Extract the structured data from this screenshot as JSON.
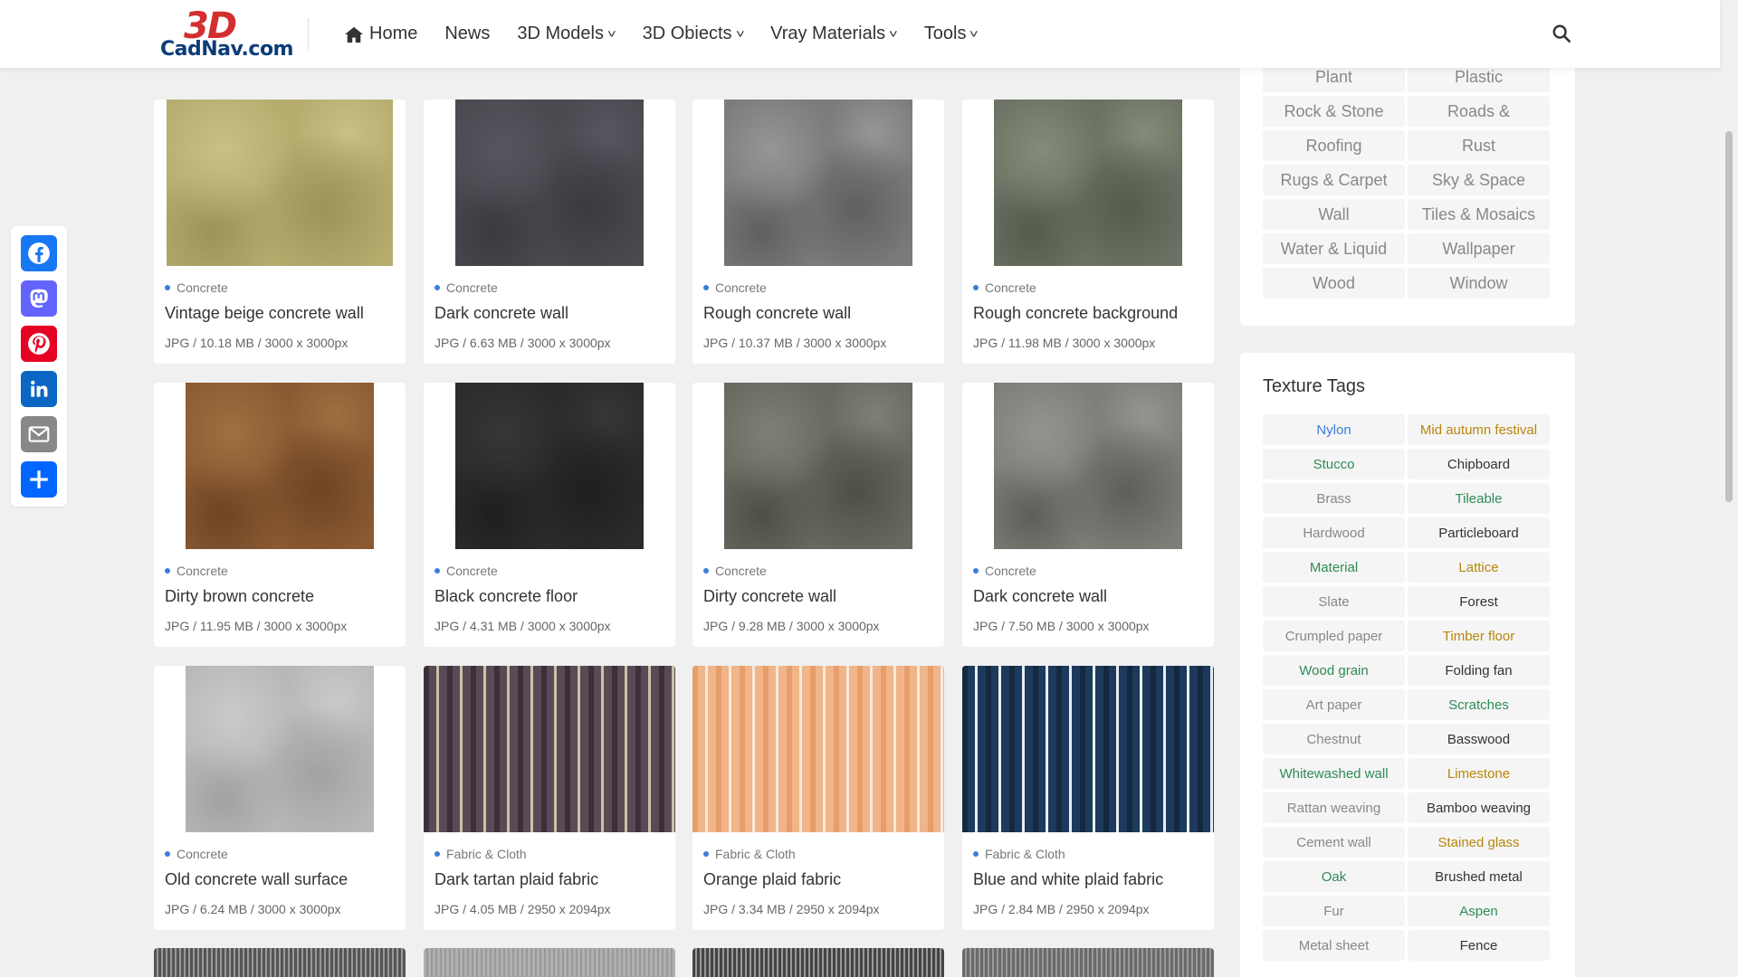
{
  "site": {
    "logo_top": "3D",
    "logo_bottom": "CadNav.com"
  },
  "nav": [
    {
      "label": "Home",
      "icon": "home-icon",
      "dropdown": false
    },
    {
      "label": "News",
      "dropdown": false
    },
    {
      "label": "3D Models",
      "dropdown": true
    },
    {
      "label": "3D Obiects",
      "dropdown": true
    },
    {
      "label": "Vray Materials",
      "dropdown": true
    },
    {
      "label": "Tools",
      "dropdown": true
    }
  ],
  "share": [
    {
      "name": "facebook",
      "color": "#1877f2"
    },
    {
      "name": "mastodon",
      "color": "#6364ff"
    },
    {
      "name": "pinterest",
      "color": "#e60023"
    },
    {
      "name": "linkedin",
      "color": "#0a66c2"
    },
    {
      "name": "email",
      "color": "#888888"
    },
    {
      "name": "share",
      "color": "#0166ff"
    }
  ],
  "cards": [
    {
      "category": "Concrete",
      "title": "Vintage beige concrete wall",
      "meta": "JPG / 10.18 MB / 3000 x 3000px",
      "swatch": [
        "#b5ac6e",
        "#9c9458",
        "#c9c184"
      ]
    },
    {
      "category": "Concrete",
      "title": "Dark concrete wall",
      "meta": "JPG / 6.63 MB / 3000 x 3000px",
      "swatch": [
        "#4a4950",
        "#3b3a41",
        "#57565e"
      ]
    },
    {
      "category": "Concrete",
      "title": "Rough concrete wall",
      "meta": "JPG / 10.37 MB / 3000 x 3000px",
      "swatch": [
        "#7a7b7b",
        "#5f6060",
        "#959696"
      ]
    },
    {
      "category": "Concrete",
      "title": "Rough concrete background",
      "meta": "JPG / 11.98 MB / 3000 x 3000px",
      "swatch": [
        "#6c7263",
        "#555b4d",
        "#858b7a"
      ]
    },
    {
      "category": "Concrete",
      "title": "Dirty brown concrete",
      "meta": "JPG / 11.95 MB / 3000 x 3000px",
      "swatch": [
        "#8a5a33",
        "#6e4424",
        "#a07040"
      ]
    },
    {
      "category": "Concrete",
      "title": "Black concrete floor",
      "meta": "JPG / 4.31 MB / 3000 x 3000px",
      "swatch": [
        "#2b2b2b",
        "#1f1f1f",
        "#363636"
      ]
    },
    {
      "category": "Concrete",
      "title": "Dirty concrete wall",
      "meta": "JPG / 9.28 MB / 3000 x 3000px",
      "swatch": [
        "#686a60",
        "#4e5048",
        "#7e8076"
      ]
    },
    {
      "category": "Concrete",
      "title": "Dark concrete wall",
      "meta": "JPG / 7.50 MB / 3000 x 3000px",
      "swatch": [
        "#7c7e78",
        "#5d5f58",
        "#93958e"
      ]
    },
    {
      "category": "Concrete",
      "title": "Old concrete wall surface",
      "meta": "JPG / 6.24 MB / 3000 x 3000px",
      "swatch": [
        "#b8b8b6",
        "#a2a2a0",
        "#cacac8"
      ]
    },
    {
      "category": "Fabric & Cloth",
      "title": "Dark tartan plaid fabric",
      "meta": "JPG / 4.05 MB / 2950 x 2094px",
      "swatch": [
        "#5a4a55",
        "#c9c2a8",
        "#3d2f3a"
      ],
      "plaid": true
    },
    {
      "category": "Fabric & Cloth",
      "title": "Orange plaid fabric",
      "meta": "JPG / 3.34 MB / 2950 x 2094px",
      "swatch": [
        "#f0b58a",
        "#fbe8da",
        "#e89d6a"
      ],
      "plaid": true
    },
    {
      "category": "Fabric & Cloth",
      "title": "Blue and white plaid fabric",
      "meta": "JPG / 2.84 MB / 2950 x 2094px",
      "swatch": [
        "#1d3a5c",
        "#e8eef3",
        "#14293f"
      ],
      "plaid": true
    }
  ],
  "categories": [
    "Plant",
    "Plastic",
    "Rock & Stone",
    "Roads &",
    "Roofing",
    "Rust",
    "Rugs & Carpet",
    "Sky & Space",
    "Wall",
    "Tiles & Mosaics",
    "Water & Liquid",
    "Wallpaper",
    "Wood",
    "Window"
  ],
  "tags_title": "Texture Tags",
  "tags": [
    {
      "label": "Nylon",
      "color": "#3b7ddd"
    },
    {
      "label": "Mid autumn festival",
      "color": "#b8860b"
    },
    {
      "label": "Stucco",
      "color": "#2e8b57"
    },
    {
      "label": "Chipboard",
      "color": "#333333"
    },
    {
      "label": "Brass",
      "color": "#888888"
    },
    {
      "label": "Tileable",
      "color": "#2e8b57"
    },
    {
      "label": "Hardwood",
      "color": "#888888"
    },
    {
      "label": "Particleboard",
      "color": "#333333"
    },
    {
      "label": "Material",
      "color": "#2e8b57"
    },
    {
      "label": "Lattice",
      "color": "#b8860b"
    },
    {
      "label": "Slate",
      "color": "#888888"
    },
    {
      "label": "Forest",
      "color": "#333333"
    },
    {
      "label": "Crumpled paper",
      "color": "#888888"
    },
    {
      "label": "Timber floor",
      "color": "#b8860b"
    },
    {
      "label": "Wood grain",
      "color": "#2e8b57"
    },
    {
      "label": "Folding fan",
      "color": "#333333"
    },
    {
      "label": "Art paper",
      "color": "#888888"
    },
    {
      "label": "Scratches",
      "color": "#2e8b57"
    },
    {
      "label": "Chestnut",
      "color": "#888888"
    },
    {
      "label": "Basswood",
      "color": "#333333"
    },
    {
      "label": "Whitewashed wall",
      "color": "#2e8b57"
    },
    {
      "label": "Limestone",
      "color": "#b8860b"
    },
    {
      "label": "Rattan weaving",
      "color": "#888888"
    },
    {
      "label": "Bamboo weaving",
      "color": "#333333"
    },
    {
      "label": "Cement wall",
      "color": "#888888"
    },
    {
      "label": "Stained glass",
      "color": "#b8860b"
    },
    {
      "label": "Oak",
      "color": "#2e8b57"
    },
    {
      "label": "Brushed metal",
      "color": "#333333"
    },
    {
      "label": "Fur",
      "color": "#888888"
    },
    {
      "label": "Aspen",
      "color": "#2e8b57"
    },
    {
      "label": "Metal sheet",
      "color": "#888888"
    },
    {
      "label": "Fence",
      "color": "#333333"
    }
  ],
  "partial_swatches": [
    "#555555",
    "#b0b0b0",
    "#444444",
    "#6a6a6a"
  ]
}
